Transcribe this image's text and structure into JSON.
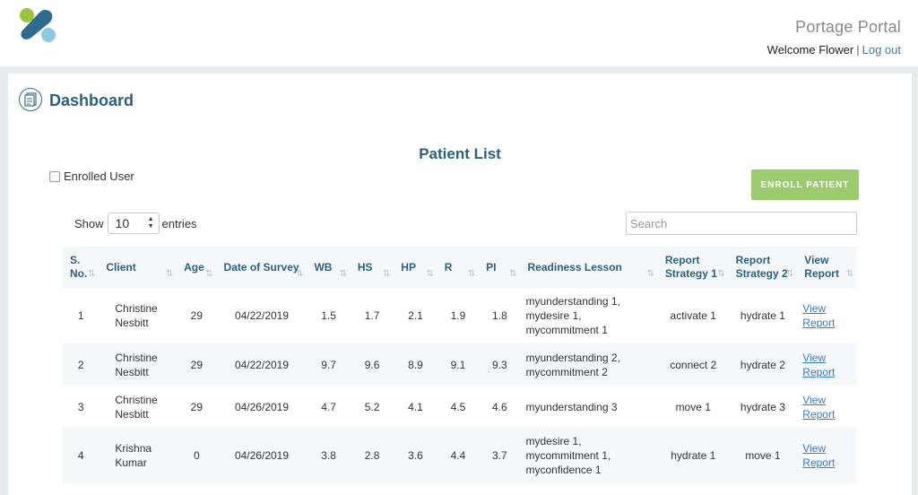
{
  "header": {
    "portal_title": "Portage Portal",
    "welcome_text": "Welcome Flower",
    "separator": "|",
    "logout_label": "Log out"
  },
  "dashboard": {
    "title": "Dashboard"
  },
  "patient_list": {
    "title": "Patient List",
    "enrolled_user_label": "Enrolled User",
    "enroll_button_label": "ENROLL PATIENT",
    "show_label": "Show",
    "entries_value": "10",
    "entries_label": "entries",
    "search_placeholder": "Search",
    "columns": [
      "S. No.",
      "Client",
      "Age",
      "Date of Survey",
      "WB",
      "HS",
      "HP",
      "R",
      "PI",
      "Readiness Lesson",
      "Report Strategy 1",
      "Report Strategy 2",
      "View Report"
    ],
    "rows": [
      {
        "sno": "1",
        "client": "Christine Nesbitt",
        "age": "29",
        "date": "04/22/2019",
        "wb": "1.5",
        "hs": "1.7",
        "hp": "2.1",
        "r": "1.9",
        "pi": "1.8",
        "lesson": "myunderstanding 1, mydesire 1, mycommitment 1",
        "strategy1": "activate 1",
        "strategy2": "hydrate 1",
        "view": "View Report"
      },
      {
        "sno": "2",
        "client": "Christine Nesbitt",
        "age": "29",
        "date": "04/22/2019",
        "wb": "9.7",
        "hs": "9.6",
        "hp": "8.9",
        "r": "9.1",
        "pi": "9.3",
        "lesson": "myunderstanding 2, mycommitment 2",
        "strategy1": "connect 2",
        "strategy2": "hydrate 2",
        "view": "View Report"
      },
      {
        "sno": "3",
        "client": "Christine Nesbitt",
        "age": "29",
        "date": "04/26/2019",
        "wb": "4.7",
        "hs": "5.2",
        "hp": "4.1",
        "r": "4.5",
        "pi": "4.6",
        "lesson": "myunderstanding 3",
        "strategy1": "move 1",
        "strategy2": "hydrate 3",
        "view": "View Report"
      },
      {
        "sno": "4",
        "client": "Krishna Kumar",
        "age": "0",
        "date": "04/26/2019",
        "wb": "3.8",
        "hs": "2.8",
        "hp": "3.6",
        "r": "4.4",
        "pi": "3.7",
        "lesson": "mydesire 1, mycommitment 1, myconfidence 1",
        "strategy1": "hydrate 1",
        "strategy2": "move 1",
        "view": "View Report"
      }
    ]
  },
  "colors": {
    "primary": "#2d5f7f",
    "link": "#3b7bbf",
    "enroll_button": "#9ccb6e",
    "row_stripe": "#f4f8fb"
  }
}
